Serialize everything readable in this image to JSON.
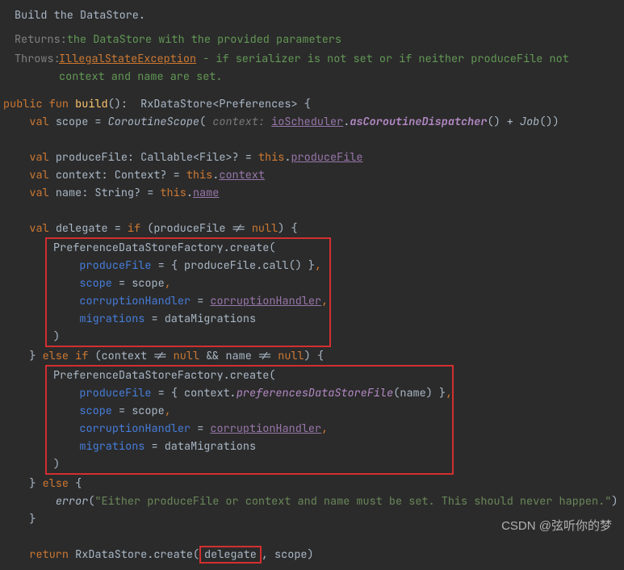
{
  "doc": {
    "title": "Build the DataStore.",
    "returns_label": "Returns:",
    "returns_text": "the DataStore with the provided parameters",
    "throws_label": "Throws:",
    "throws_exc": "IllegalStateException",
    "throws_text": " - if serializer is not set or if neither produceFile not context and name are set."
  },
  "code": {
    "kw_public": "public",
    "kw_fun": "fun",
    "fn_build": "build",
    "sig_rest": "():  RxDataStore<Preferences> {",
    "kw_val": "val",
    "scope_eq": " scope = ",
    "corScope": "CoroutineScope",
    "lparen": "(",
    "hint_context": " context: ",
    "ioScheduler": "ioScheduler",
    "dot": ".",
    "asCorDisp": "asCoroutineDispatcher",
    "plusJob": "() + ",
    "Job": "Job",
    "jobTail": "())",
    "pf_decl": " produceFile: Callable<File>? = ",
    "kw_this": "this",
    "produceFile_u": "produceFile",
    "ctx_decl": " context: Context? = ",
    "context_u": "context",
    "name_decl": " name: String? = ",
    "name_u": "name",
    "del_decl": " delegate = ",
    "kw_if": "if",
    "if_open": " (produceFile != ",
    "kw_null": "null",
    "if_close": ") {",
    "pdsf_create": "PreferenceDataStoreFactory.create(",
    "arg_produceFile": "produceFile",
    "eq_brace": " = { ",
    "pf_call": "produceFile",
    "call_tail": ".call() }",
    "arg_scope": "scope",
    "eq_scope": " = scope",
    "arg_corruption": "corruptionHandler",
    "eq_sp": " = ",
    "corruptionHandler_u": "corruptionHandler",
    "arg_migrations": "migrations",
    "eq_migrations": " = dataMigrations",
    "rparen": ")",
    "rbrace_sp": "} ",
    "kw_else": "else",
    "elseif_open": " (context != ",
    "and_name": " && name != ",
    "ctx_ident": "context",
    "prefDSFile": "preferencesDataStoreFile",
    "name_call_open": "(",
    "name_ident": "name",
    "name_call_close": ") }",
    "else_brace": " {",
    "error_fn": "error",
    "error_open": "(",
    "error_str": "\"Either produceFile or context and name must be set. This should never happen.\"",
    "error_close": ")",
    "rbrace": "}",
    "kw_return": "return",
    "return_pre": " RxDataStore.create(",
    "delegate_boxed": "delegate",
    "return_post": ", scope)"
  },
  "watermark": "CSDN @弦听你的梦"
}
